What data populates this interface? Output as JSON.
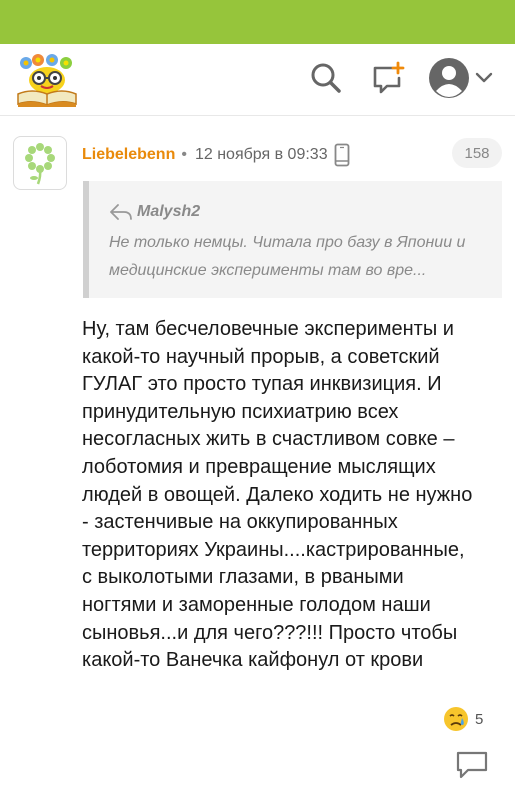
{
  "header": {
    "logo_icon": "smiley-book-logo",
    "icons": [
      "search-icon",
      "new-message-icon",
      "user-avatar-icon",
      "chevron-down-icon"
    ]
  },
  "comment": {
    "author": "Liebelebenn",
    "separator": "•",
    "timestamp": "12 ноября в 09:33",
    "device_icon": "mobile-phone-icon",
    "count": "158",
    "quote": {
      "author": "Malysh2",
      "text": "Не только немцы. Читала про базу в Японии и медицинские эксперименты там во вре..."
    },
    "body_lines": [
      "Ну, там бесчеловечные эксперименты и",
      "какой-то научный прорыв, а советский",
      "ГУЛАГ это просто тупая инквизиция. И",
      "принудительную психиатрию всех",
      "несогласных жить в счастливом совке –",
      "лоботомия и превращение мыслящих",
      "людей в овощей. Далеко ходить не нужно",
      "- застенчивые на оккупированных",
      "территориях Украины....кастрированные,",
      "с выколотыми глазами, в рваными",
      "ногтями и заморенные голодом наши",
      "сыновья...и для чего???!!! Просто чтобы",
      "какой-то Ванечка кайфонул от крови"
    ],
    "reaction": {
      "emoji": "crying-face",
      "count": "5"
    }
  },
  "colors": {
    "brand_green": "#96c53b",
    "author_orange": "#e98a0b"
  }
}
